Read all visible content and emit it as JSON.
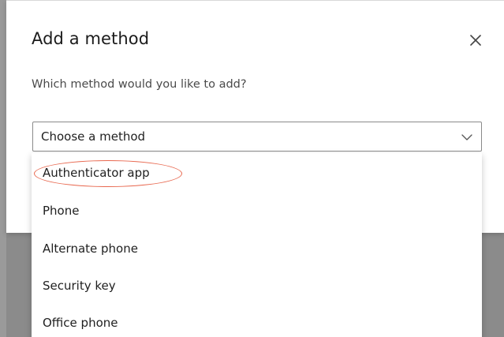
{
  "dialog": {
    "title": "Add a method",
    "prompt": "Which method would you like to add?",
    "close_icon": "close-icon"
  },
  "select": {
    "value": "Choose a method",
    "chevron_icon": "chevron-down-icon",
    "options": [
      "Authenticator app",
      "Phone",
      "Alternate phone",
      "Security key",
      "Office phone"
    ]
  },
  "annotation": {
    "highlight_color": "#e8684f",
    "highlighted_option": "Authenticator app"
  },
  "colors": {
    "backdrop": "#8b8b8b",
    "dialog_bg": "#ffffff",
    "text": "#1f1f1f"
  }
}
